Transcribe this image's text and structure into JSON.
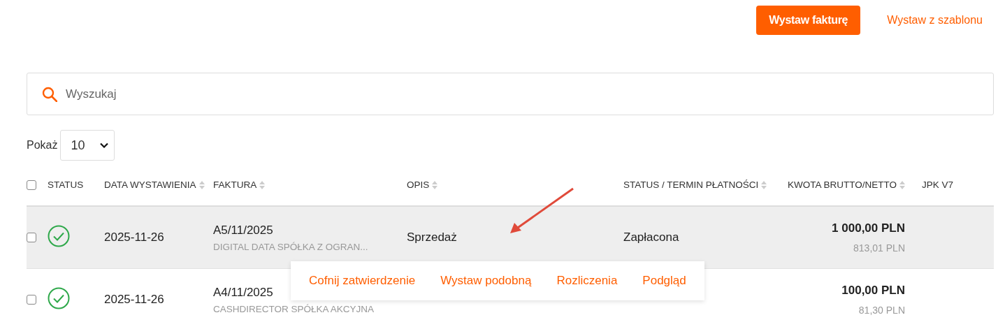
{
  "actions": [
    {
      "kind": "button",
      "label": "Wystaw fakturę"
    },
    {
      "kind": "link",
      "label": "Wystaw z szablonu"
    }
  ],
  "search": {
    "placeholder": "Wyszukaj"
  },
  "page_size": {
    "label": "Pokaż",
    "value": "10"
  },
  "table": {
    "select_all": {
      "checked": false
    },
    "columns": [
      {
        "label": "STATUS",
        "sortable": false
      },
      {
        "label": "DATA WYSTAWIENIA",
        "sortable": true
      },
      {
        "label": "FAKTURA",
        "sortable": true
      },
      {
        "label": "OPIS",
        "sortable": true
      },
      {
        "label": "STATUS / TERMIN PŁATNOŚCI",
        "sortable": true
      },
      {
        "label": "KWOTA BRUTTO/NETTO",
        "sortable": true
      },
      {
        "label": "JPK V7",
        "sortable": false
      }
    ],
    "rows": [
      {
        "checked": false,
        "highlighted": true,
        "kind": "paid",
        "date": "2025-11-26",
        "invoice": "A5/11/2025",
        "client": "DIGITAL DATA SPÓŁKA Z OGRAN...",
        "description": "Sprzedaż",
        "payment_status": "Zapłacona",
        "gross": "1 000,00 PLN",
        "net": "813,01 PLN"
      },
      {
        "checked": false,
        "highlighted": false,
        "kind": "paid",
        "date": "2025-11-26",
        "invoice": "A4/11/2025",
        "client": "CASHDIRECTOR SPÓŁKA AKCYJNA",
        "gross": "100,00 PLN",
        "net": "81,30 PLN"
      }
    ]
  },
  "row_menu": {
    "items": [
      "Cofnij zatwierdzenie",
      "Wystaw podobną",
      "Rozliczenia",
      "Podgląd"
    ]
  }
}
